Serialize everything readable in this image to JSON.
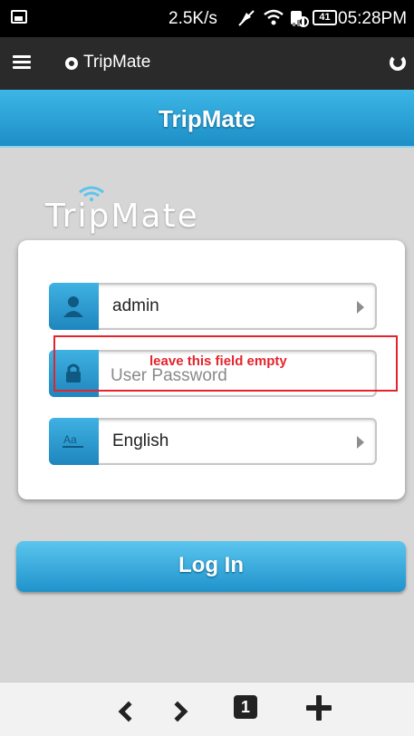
{
  "status_bar": {
    "speed": "2.5K/s",
    "battery_level": "41",
    "time": "05:28PM",
    "icons": [
      "image-icon",
      "mute-icon",
      "wifi-icon",
      "sim-icon",
      "signal-icon",
      "battery-icon"
    ]
  },
  "browser": {
    "tab_title": "TripMate",
    "icons": [
      "menu-icon",
      "site-icon",
      "refresh-icon"
    ]
  },
  "header": {
    "title": "TripMate"
  },
  "logo": {
    "text": "TripMate"
  },
  "form": {
    "username": {
      "value": "admin",
      "icon": "user-icon"
    },
    "password": {
      "placeholder": "User Password",
      "value": "",
      "icon": "lock-icon"
    },
    "language": {
      "value": "English",
      "icon": "language-icon"
    }
  },
  "annotation": {
    "text": "leave this field empty",
    "color": "#e4242c"
  },
  "login_button": {
    "label": "Log In"
  },
  "bottom_nav": {
    "tab_count": "1",
    "icons": [
      "back-icon",
      "forward-icon",
      "tabs-icon",
      "new-tab-icon"
    ]
  },
  "colors": {
    "accent": "#2aa3d8",
    "header_top": "#3cb6e6",
    "header_bottom": "#1d8fc6",
    "background": "#d6d6d6"
  }
}
